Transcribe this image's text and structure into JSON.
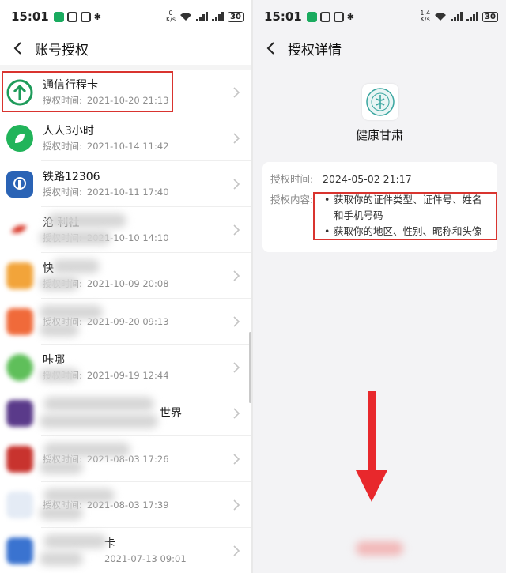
{
  "left": {
    "status": {
      "time": "15:01",
      "speed_value": "0",
      "speed_unit": "K/s",
      "battery": "30"
    },
    "nav": {
      "title": "账号授权"
    },
    "auth_label": "授权时间:",
    "items": [
      {
        "name": "通信行程卡",
        "time": "2021-10-20 21:13",
        "icon": "arrow-up-icon",
        "color": "#1e9b5a"
      },
      {
        "name": "人人3小时",
        "time": "2021-10-14 11:42",
        "icon": "leaf-icon",
        "color": "#21b45a"
      },
      {
        "name": "铁路12306",
        "time": "2021-10-11 17:40",
        "icon": "railway-icon",
        "color": "#2a63b5"
      },
      {
        "name": "沧          利社",
        "time": "2021-10-10 14:10",
        "icon": "red-bird-icon",
        "color": "#d93a2b"
      },
      {
        "name": "快",
        "time": "2021-10-09 20:08",
        "icon": "orange-app-icon",
        "color": "#f2a43a"
      },
      {
        "name": "",
        "time": "2021-09-20 09:13",
        "icon": "orange-card-icon",
        "color": "#f06a3a"
      },
      {
        "name": "咔哪",
        "time": "2021-09-19 12:44",
        "icon": "green-app-icon",
        "color": "#5fbf5a"
      },
      {
        "name": "世界",
        "time": "",
        "icon": "purple-app-icon",
        "color": "#5a3a8a"
      },
      {
        "name": "",
        "time": "2021-08-03 17:26",
        "icon": "red-card-icon",
        "color": "#c8332e"
      },
      {
        "name": "",
        "time": "2021-08-03 17:39",
        "icon": "doc-app-icon",
        "color": "#8aa4c8"
      },
      {
        "name": "卡",
        "time": "2021-07-13 09:01",
        "icon": "blue-app-icon",
        "color": "#3a73d0"
      }
    ]
  },
  "right": {
    "status": {
      "time": "15:01",
      "speed_value": "1.4",
      "speed_unit": "K/s",
      "battery": "30"
    },
    "nav": {
      "title": "授权详情"
    },
    "app_name": "健康甘肃",
    "auth_time_label": "授权时间:",
    "auth_time": "2024-05-02 21:17",
    "auth_content_label": "授权内容:",
    "permissions": [
      "获取你的证件类型、证件号、姓名和手机号码",
      "获取你的地区、性别、昵称和头像"
    ]
  },
  "colors": {
    "highlight": "#d9342f",
    "arrow": "#e8282c",
    "meta_text": "#8d8d8d"
  }
}
